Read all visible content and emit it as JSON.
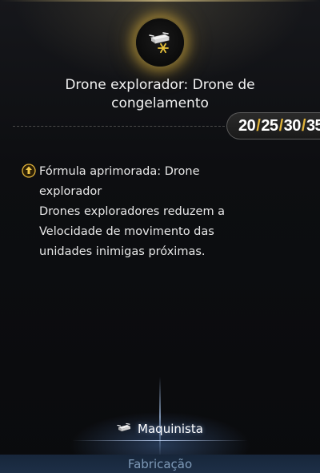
{
  "skill": {
    "icon": "frost-drone-icon",
    "title_line1": "Drone explorador: Drone de",
    "title_line2": "congelamento",
    "levels": [
      "20",
      "25",
      "30",
      "35"
    ]
  },
  "description": {
    "bullet_icon": "upgrade-arrow-icon",
    "lines": [
      "Fórmula aprimorada: Drone",
      "explorador",
      "Drones exploradores reduzem a",
      "Velocidade de movimento das",
      "unidades inimigas próximas."
    ]
  },
  "class": {
    "icon": "drone-icon",
    "label": "Maquinista"
  },
  "tab": {
    "label": "Fabricação"
  },
  "colors": {
    "accent_gold": "#e2b43a",
    "tab_text": "#7e9ab8",
    "background": "#0a0b0e"
  }
}
